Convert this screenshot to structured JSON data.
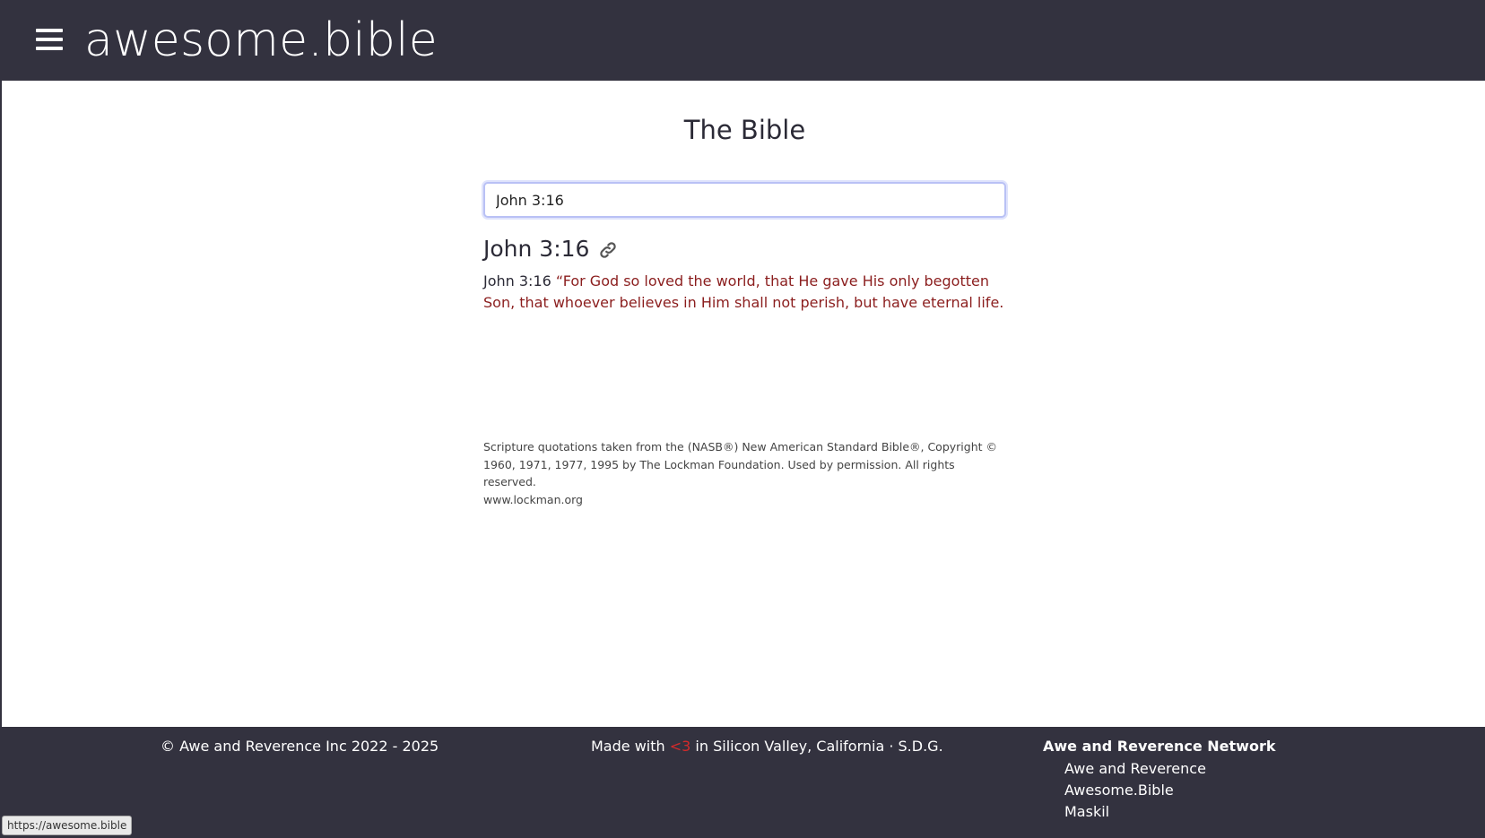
{
  "header": {
    "site_title": "awesome.bible"
  },
  "main": {
    "page_title": "The Bible",
    "search": {
      "value": "John 3:16"
    },
    "verse": {
      "heading": "John 3:16",
      "ref": "John 3:16",
      "text": "“For God so loved the world, that He gave His only begotten Son, that whoever believes in Him shall not perish, but have eternal life."
    },
    "copyright": {
      "text": "Scripture quotations taken from the (NASB®) New American Standard Bible®, Copyright © 1960, 1971, 1977, 1995 by The Lockman Foundation. Used by permission. All rights reserved.",
      "link": "www.lockman.org"
    }
  },
  "footer": {
    "copyright": "© Awe and Reverence Inc 2022 - 2025",
    "made_prefix": "Made with",
    "made_heart": "<3",
    "made_suffix": "in Silicon Valley, California · S.D.G.",
    "network_title": "Awe and Reverence Network",
    "network_links": [
      "Awe and Reverence",
      "Awesome.Bible",
      "Maskil"
    ]
  },
  "status_bar": {
    "url": "https://awesome.bible"
  },
  "colors": {
    "header_bg": "#33323f",
    "verse_red": "#8b1e1e",
    "heart_red": "#d42a2a"
  }
}
